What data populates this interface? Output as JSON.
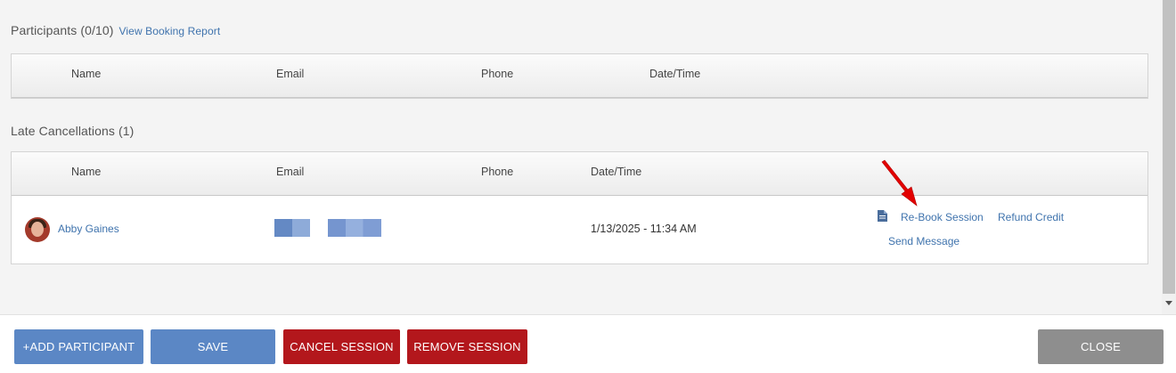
{
  "participants": {
    "title": "Participants (0/10)",
    "report_link": "View Booking Report",
    "headers": [
      "Name",
      "Email",
      "Phone",
      "Date/Time"
    ]
  },
  "late_cancellations": {
    "title": "Late Cancellations (1)",
    "headers": [
      "Name",
      "Email",
      "Phone",
      "Date/Time"
    ],
    "rows": [
      {
        "name": "Abby Gaines",
        "datetime": "1/13/2025 - 11:34 AM",
        "actions": {
          "rebook": "Re-Book Session",
          "refund": "Refund Credit",
          "message": "Send Message"
        }
      }
    ]
  },
  "footer": {
    "add_participant": "+ADD PARTICIPANT",
    "save": "SAVE",
    "cancel_session": "CANCEL SESSION",
    "remove_session": "REMOVE SESSION",
    "close": "CLOSE"
  },
  "colors": {
    "link": "#3f73ad",
    "primary_button": "#5b87c5",
    "danger_button": "#b3171c",
    "neutral_button": "#8e8e8e",
    "annotation_arrow": "#e30000"
  }
}
